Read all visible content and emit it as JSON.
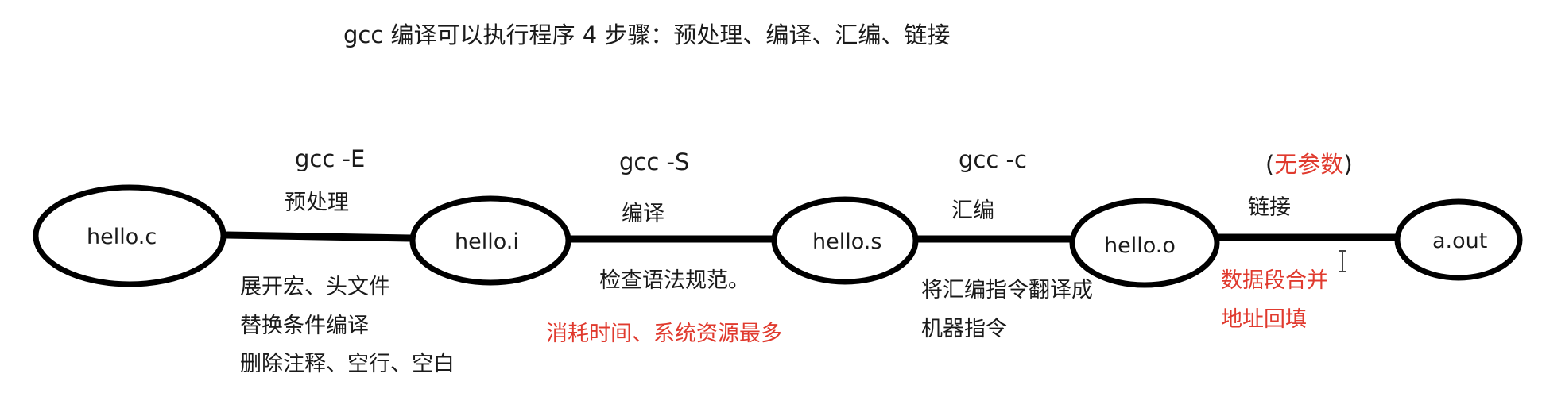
{
  "title": "gcc 编译可以执行程序  4 步骤：预处理、编译、汇编、链接",
  "nodes": {
    "hello_c": "hello.c",
    "hello_i": "hello.i",
    "hello_s": "hello.s",
    "hello_o": "hello.o",
    "a_out": "a.out"
  },
  "steps": {
    "preprocess": {
      "command": "gcc   -E",
      "name": "预处理",
      "notes": [
        "展开宏、头文件",
        "替换条件编译",
        "删除注释、空行、空白"
      ]
    },
    "compile": {
      "command": "gcc -S",
      "name": "编译",
      "note": "检查语法规范。",
      "warning": "消耗时间、系统资源最多"
    },
    "assemble": {
      "command": "gcc -c",
      "name": "汇编",
      "notes": [
        "将汇编指令翻译成",
        "机器指令"
      ]
    },
    "link": {
      "command_open": "(",
      "command": "无参数",
      "command_close": ")",
      "name": "链接",
      "notes": [
        "数据段合并",
        "地址回填"
      ]
    }
  },
  "colors": {
    "text": "#1a1a1a",
    "accent_red": "#e03a2e",
    "line": "#000000"
  }
}
